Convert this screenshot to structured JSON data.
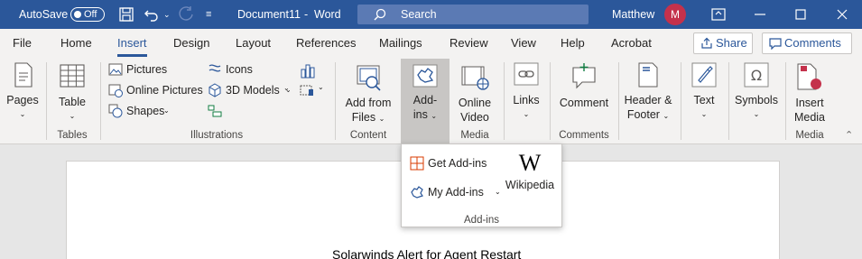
{
  "titlebar": {
    "autosave_label": "AutoSave",
    "autosave_state": "Off",
    "doc_title": "Document11",
    "separator": "-",
    "app_name": "Word",
    "search_placeholder": "Search",
    "user_name": "Matthew",
    "avatar_initial": "M",
    "bg_color": "#2b579a"
  },
  "tabs": [
    "File",
    "Home",
    "Insert",
    "Design",
    "Layout",
    "References",
    "Mailings",
    "Review",
    "View",
    "Help",
    "Acrobat"
  ],
  "active_tab": "Insert",
  "share_label": "Share",
  "comments_label": "Comments",
  "ribbon": {
    "pages": "Pages",
    "table": "Table",
    "pictures": "Pictures",
    "online_pictures": "Online Pictures",
    "shapes": "Shapes",
    "icons": "Icons",
    "models_3d": "3D Models",
    "add_from_files_1": "Add from",
    "add_from_files_2": "Files",
    "addins_1": "Add-",
    "addins_2": "ins",
    "online_video_1": "Online",
    "online_video_2": "Video",
    "links": "Links",
    "comment": "Comment",
    "header_footer_1": "Header &",
    "header_footer_2": "Footer",
    "text": "Text",
    "symbols": "Symbols",
    "insert_media_1": "Insert",
    "insert_media_2": "Media",
    "groups": {
      "tables": "Tables",
      "illustrations": "Illustrations",
      "content": "Content",
      "media": "Media",
      "comments": "Comments",
      "media2": "Media"
    }
  },
  "dropdown": {
    "get_addins": "Get Add-ins",
    "my_addins": "My Add-ins",
    "wikipedia_glyph": "W",
    "wikipedia": "Wikipedia",
    "footer": "Add-ins"
  },
  "document": {
    "text": "Solarwinds Alert for Agent Restart"
  }
}
